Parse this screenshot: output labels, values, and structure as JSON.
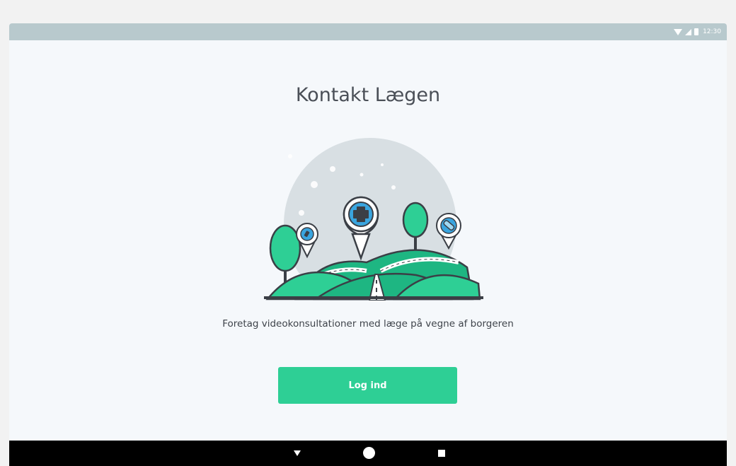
{
  "status_bar": {
    "clock": "12:30",
    "icons": [
      "wifi-icon",
      "signal-icon",
      "battery-icon"
    ],
    "background": "#b8c9cd"
  },
  "screen": {
    "title": "Kontakt Lægen",
    "subtitle": "Foretag videokonsultationer med læge på vegne af borgeren",
    "illustration": "hills-with-location-pins-illustration"
  },
  "actions": {
    "login_label": "Log ind"
  },
  "nav_bar": {
    "buttons": [
      "back-icon",
      "home-icon",
      "recents-icon"
    ]
  },
  "colors": {
    "accent": "#2ecf95",
    "title_text": "#4a4f57",
    "background": "#f5f8fb"
  }
}
